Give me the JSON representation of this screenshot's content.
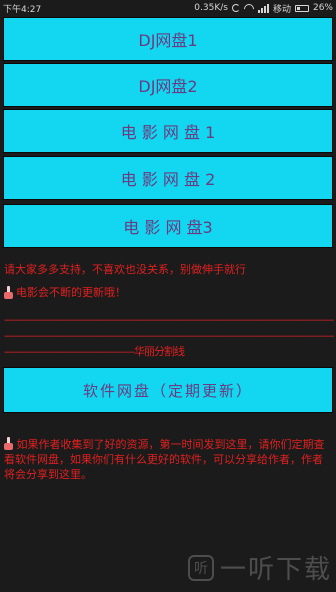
{
  "status_bar": {
    "time": "下午4:27",
    "net_speed": "0.35K/s",
    "carrier": "移动",
    "battery": "26%"
  },
  "buttons": [
    {
      "label": "DJ网盘1"
    },
    {
      "label": "DJ网盘2"
    },
    {
      "label": "电 影 网 盘 1"
    },
    {
      "label": "电 影 网 盘 2"
    },
    {
      "label": "电 影 网 盘3"
    }
  ],
  "notice": {
    "line1": "请大家多多支持，不喜欢也没关系，别做伸手就行",
    "line2": "电影会不断的更新哦！"
  },
  "divider": {
    "dashes1": "——————————————————————————————————————",
    "dashes2": "——————————————————————————————————————",
    "prefix": "—————————————",
    "label": "华丽分割线"
  },
  "software_button": {
    "label": "软件网盘（定期更新）"
  },
  "info_text": "如果作者收集到了好的资源，第一时间发到这里，请你们定期查看软件网盘，如果你们有什么更好的软件，可以分享给作者，作者将会分享到这里。",
  "watermark": {
    "text": "一听下载",
    "logo": "听"
  },
  "colors": {
    "button_bg": "#13d7f0",
    "button_text": "#6b3a80",
    "notice_text": "#e02020",
    "background": "#1b1b1b"
  }
}
